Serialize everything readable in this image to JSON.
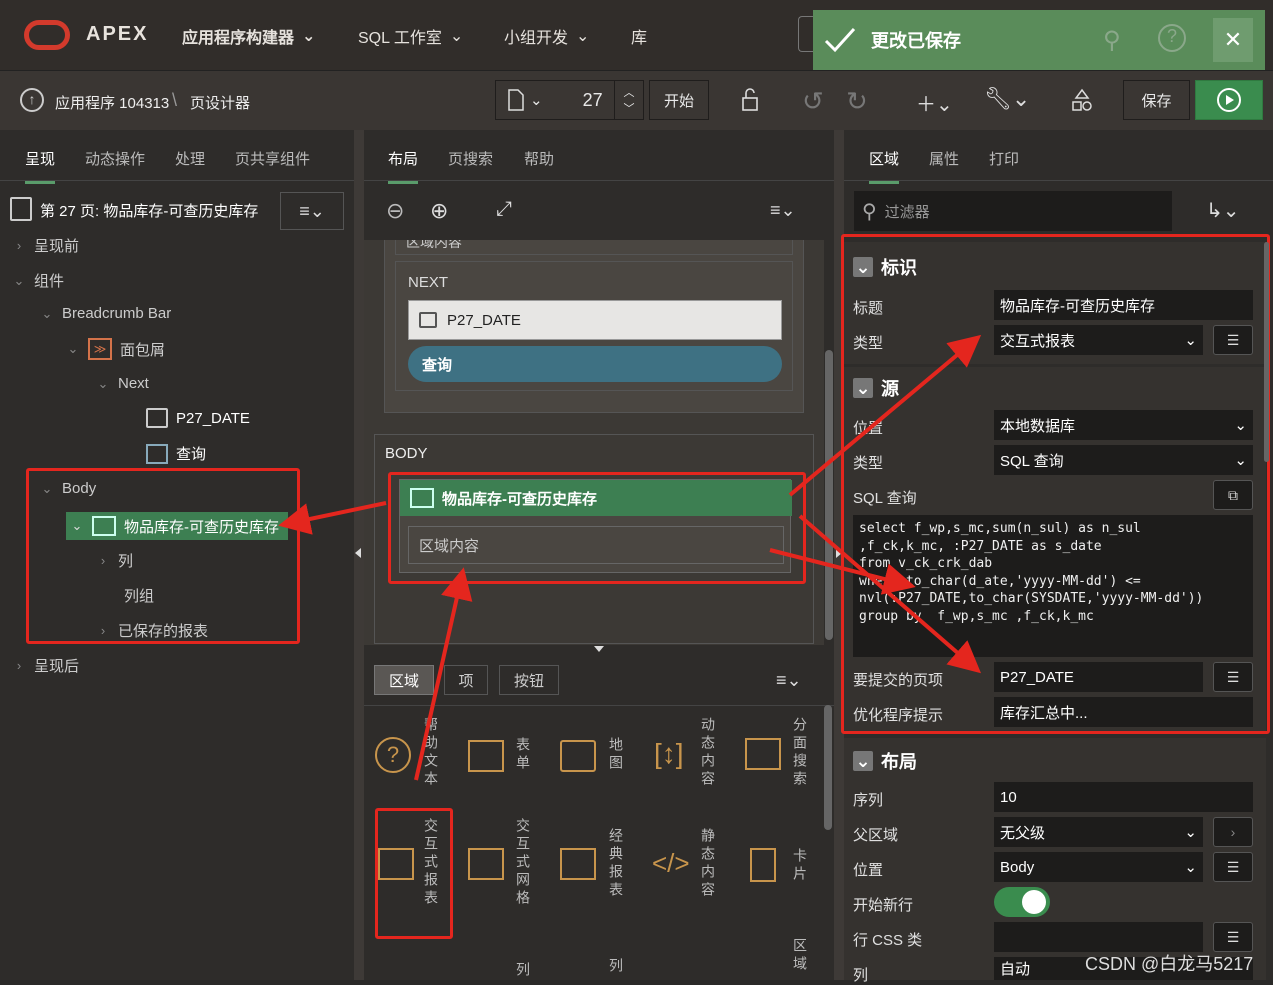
{
  "topnav": {
    "brand": "APEX",
    "app_builder": "应用程序构建器",
    "sql_workshop": "SQL 工作室",
    "team_dev": "小组开发",
    "gallery": "库"
  },
  "toast": {
    "message": "更改已保存"
  },
  "breadcrumb": {
    "app": "应用程序 104313",
    "sep": "\\",
    "page": "页设计器"
  },
  "toolbar": {
    "page_number": "27",
    "start_label": "开始",
    "save_label": "保存"
  },
  "left": {
    "tabs": [
      "呈现",
      "动态操作",
      "处理",
      "页共享组件"
    ],
    "page_title": "第 27 页: 物品库存-可查历史库存",
    "tree": {
      "before": "呈现前",
      "components": "组件",
      "breadcrumb_bar": "Breadcrumb Bar",
      "breadcrumb": "面包屑",
      "next": "Next",
      "p27_date": "P27_DATE",
      "query": "查询",
      "body": "Body",
      "region": "物品库存-可查历史库存",
      "columns": "列",
      "column_groups": "列组",
      "saved_reports": "已保存的报表",
      "after": "呈现后"
    }
  },
  "middle": {
    "tabs": [
      "布局",
      "页搜索",
      "帮助"
    ],
    "region_content_top": "区域内容",
    "next_label": "NEXT",
    "p27_date": "P27_DATE",
    "query_btn": "查询",
    "body_label": "BODY",
    "region_title": "物品库存-可查历史库存",
    "region_content": "区域内容",
    "gallery_tabs": [
      "区域",
      "项",
      "按钮"
    ],
    "gallery": [
      "帮助文本",
      "表单",
      "地图",
      "动态内容",
      "分面搜索",
      "交互式报表",
      "交互式网格",
      "经典报表",
      "静态内容",
      "卡片",
      "列",
      "列",
      "区域"
    ]
  },
  "right": {
    "tabs": [
      "区域",
      "属性",
      "打印"
    ],
    "filter_placeholder": "过滤器",
    "identity": {
      "title": "标识",
      "title_label": "标题",
      "title_value": "物品库存-可查历史库存",
      "type_label": "类型",
      "type_value": "交互式报表"
    },
    "source": {
      "title": "源",
      "location_label": "位置",
      "location_value": "本地数据库",
      "type_label": "类型",
      "type_value": "SQL 查询",
      "sql_label": "SQL 查询",
      "sql": "select f_wp,s_mc,sum(n_sul) as n_sul\n,f_ck,k_mc, :P27_DATE as s_date\nfrom v_ck_crk_dab\nwhere to_char(d_ate,'yyyy-MM-dd') <=\nnvl(:P27_DATE,to_char(SYSDATE,'yyyy-MM-dd'))\ngroup by  f_wp,s_mc ,f_ck,k_mc",
      "submit_label": "要提交的页项",
      "submit_value": "P27_DATE",
      "hint_label": "优化程序提示",
      "hint_value": "库存汇总中..."
    },
    "layout": {
      "title": "布局",
      "seq_label": "序列",
      "seq_value": "10",
      "parent_label": "父区域",
      "parent_value": "无父级",
      "position_label": "位置",
      "position_value": "Body",
      "newrow_label": "开始新行",
      "css_label": "行 CSS 类",
      "col_label": "列",
      "col_value": "自动"
    }
  },
  "watermark": "CSDN @白龙马5217",
  "colors": {
    "accent": "#3d7f52",
    "toast": "#5a8c5a",
    "highlight": "#e4261e",
    "run": "#3a8c4e"
  }
}
